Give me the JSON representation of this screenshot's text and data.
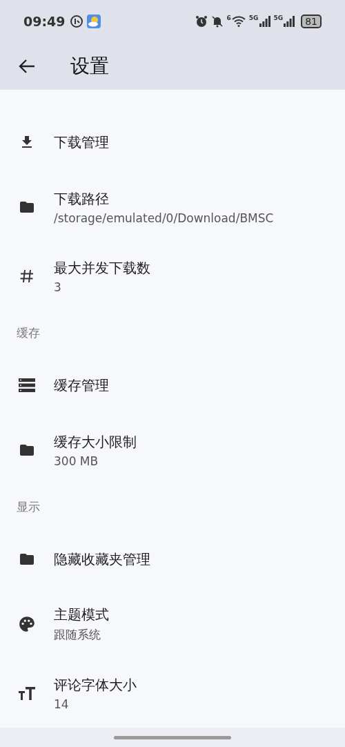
{
  "status_bar": {
    "time": "09:49",
    "wifi_badge": "6",
    "signals": [
      "5G",
      "5G"
    ],
    "battery": "81"
  },
  "app_bar": {
    "title": "设置"
  },
  "sections": [
    {
      "items": [
        {
          "kind": "download",
          "title": "下载管理"
        },
        {
          "kind": "folder",
          "title": "下载路径",
          "subtitle": "/storage/emulated/0/Download/BMSC"
        },
        {
          "kind": "hash",
          "title": "最大并发下载数",
          "subtitle": "3"
        }
      ]
    },
    {
      "header": "缓存",
      "items": [
        {
          "kind": "storage",
          "title": "缓存管理"
        },
        {
          "kind": "folder",
          "title": "缓存大小限制",
          "subtitle": "300 MB"
        }
      ]
    },
    {
      "header": "显示",
      "items": [
        {
          "kind": "folder",
          "title": "隐藏收藏夹管理"
        },
        {
          "kind": "palette",
          "title": "主题模式",
          "subtitle": "跟随系统"
        },
        {
          "kind": "textsize",
          "title": "评论字体大小",
          "subtitle": "14"
        }
      ]
    }
  ]
}
